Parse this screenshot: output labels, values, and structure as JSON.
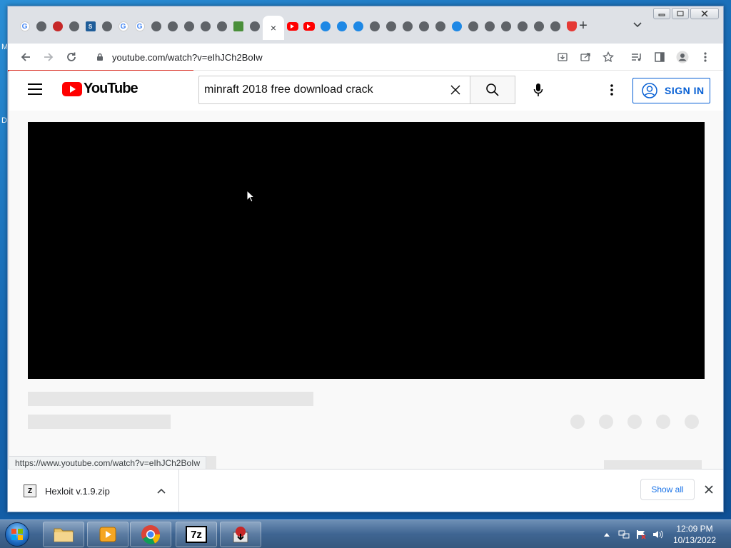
{
  "desktop": {
    "left_glyph_m": "M",
    "left_glyph_d": "D"
  },
  "browser": {
    "url": "youtube.com/watch?v=eIhJCh2BoIw",
    "active_tab_close": "×",
    "new_tab": "+"
  },
  "youtube": {
    "logo_text": "YouTube",
    "search_value": "minraft 2018 free download crack",
    "sign_in_label": "SIGN IN"
  },
  "status_bar": {
    "url": "https://www.youtube.com/watch?v=eIhJCh2BoIw"
  },
  "downloads": {
    "file_name": "Hexloit v.1.9.zip",
    "file_icon_letter": "Z",
    "show_all_label": "Show all"
  },
  "taskbar": {
    "time": "12:09 PM",
    "date": "10/13/2022",
    "app_7zip_label": "7z"
  },
  "colors": {
    "youtube_red": "#ff0000",
    "link_blue": "#065fd4"
  }
}
